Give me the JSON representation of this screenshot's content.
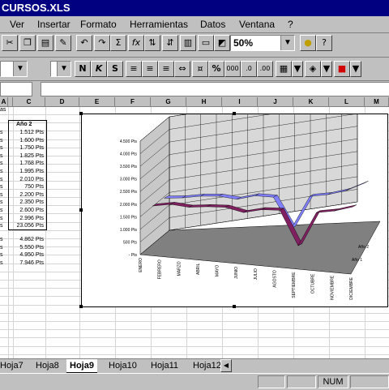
{
  "window": {
    "title": "CURSOS.XLS"
  },
  "menu": [
    {
      "label": "Ver"
    },
    {
      "label": "Insertar"
    },
    {
      "label": "Formato"
    },
    {
      "label": "Herramientas"
    },
    {
      "label": "Datos"
    },
    {
      "label": "Ventana"
    },
    {
      "label": "?"
    }
  ],
  "toolbar": {
    "zoom_value": "50%",
    "sum_label": "Σ",
    "fx_label": "fx",
    "bold_label": "N",
    "italic_label": "K",
    "underline_label": "S",
    "percent_label": "%",
    "thousands_label": "000"
  },
  "columns": [
    "A",
    "B",
    "C",
    "D",
    "E",
    "F",
    "G",
    "H",
    "I",
    "J",
    "K",
    "L",
    "M"
  ],
  "sheet": {
    "header_fragment": "as",
    "col_c_header": "Año 2",
    "col_c_values": [
      "1.512 Pts",
      "1.600 Pts",
      "1.750 Pts",
      "1.825 Pts",
      "1.768 Pts",
      "1.995 Pts",
      "2.010 Pts",
      "750 Pts",
      "2.200 Pts",
      "2.350 Pts",
      "2.600 Pts",
      "2.996 Pts",
      "23.056 Pts"
    ],
    "col_b_fragments": [
      "s",
      "s",
      "s",
      "s",
      "s",
      "s",
      "s",
      "s",
      "s",
      "s",
      "s",
      "s",
      "s"
    ],
    "lower_values": [
      "4.862 Pts",
      "5.550 Pts",
      "4.950 Pts",
      "7.946 Pts"
    ],
    "lower_fragments": [
      "s",
      "s",
      "s",
      "s"
    ]
  },
  "chart_data": {
    "type": "line",
    "categories": [
      "ENERO",
      "FEBRERO",
      "MARZO",
      "ABRIL",
      "MAYO",
      "JUNIO",
      "JULIO",
      "AGOSTO",
      "SEPTIEMBRE",
      "OCTUBRE",
      "NOVIEMBRE",
      "DICIEMBRE"
    ],
    "series": [
      {
        "name": "Año 1",
        "values": [
          1600,
          1750,
          1700,
          1800,
          1850,
          1700,
          1900,
          1950,
          500,
          2000,
          2150,
          2400
        ],
        "color": "#802060"
      },
      {
        "name": "Año 2",
        "values": [
          1512,
          1600,
          1750,
          1825,
          1768,
          1995,
          2010,
          750,
          2200,
          2350,
          2600,
          2996
        ],
        "color": "#8080ff"
      }
    ],
    "ylim": [
      0,
      4500
    ],
    "yticks": [
      "- Pts",
      "500 Pts",
      "1.000 Pts",
      "1.500 Pts",
      "2.000 Pts",
      "2.500 Pts",
      "3.000 Pts",
      "3.500 Pts",
      "4.000 Pts",
      "4.500 Pts"
    ],
    "depth_labels": [
      "Año 1",
      "Año 2"
    ]
  },
  "tabs": [
    {
      "label": "Hoja7"
    },
    {
      "label": "Hoja8"
    },
    {
      "label": "Hoja9"
    },
    {
      "label": "Hoja10"
    },
    {
      "label": "Hoja11"
    },
    {
      "label": "Hoja12"
    }
  ],
  "status": {
    "num": "NUM"
  }
}
